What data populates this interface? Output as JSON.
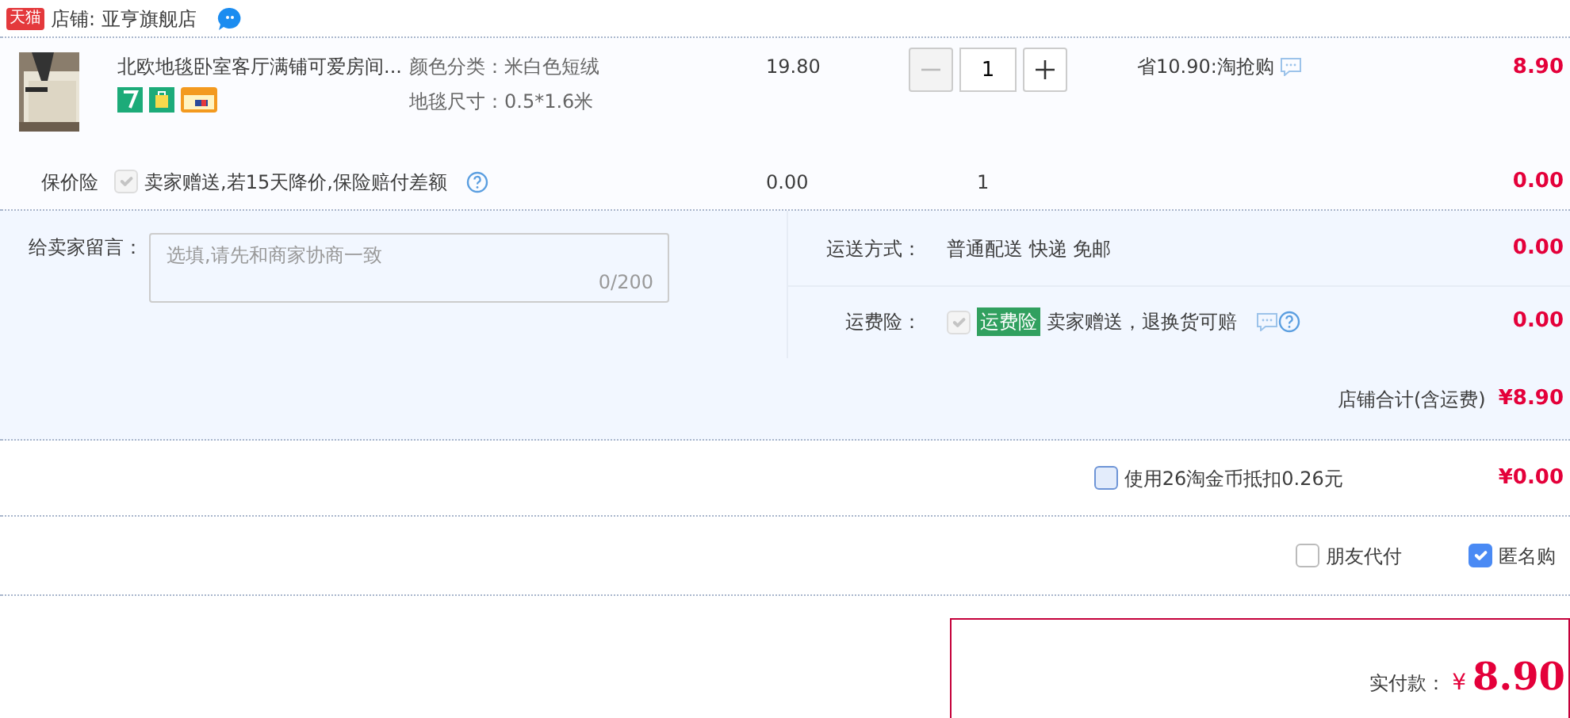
{
  "shop": {
    "badge": "天猫",
    "label": "店铺: 亚亨旗舰店"
  },
  "item": {
    "title": "北欧地毯卧室客厅满铺可爱房间...",
    "sku": [
      "颜色分类：米白色短绒",
      "地毯尺寸：0.5*1.6米"
    ],
    "price": "19.80",
    "quantity": "1",
    "promo": "省10.90:淘抢购",
    "subtotal": "8.90"
  },
  "price_protection": {
    "label": "保价险",
    "checked": true,
    "disabled": true,
    "text": "卖家赠送,若15天降价,保险赔付差额",
    "price": "0.00",
    "quantity": "1",
    "subtotal": "0.00"
  },
  "message": {
    "label": "给卖家留言：",
    "placeholder": "选填,请先和商家协商一致",
    "counter": "0/200"
  },
  "shipping": {
    "label": "运送方式：",
    "value": "普通配送 快递 免邮",
    "fee": "0.00"
  },
  "freight_insurance": {
    "label": "运费险：",
    "checked": true,
    "disabled": true,
    "tag": "运费险",
    "text": "卖家赠送，退换货可赔",
    "fee": "0.00"
  },
  "shop_total": {
    "label": "店铺合计(含运费)",
    "value": "¥8.90"
  },
  "coins": {
    "checked": false,
    "label": "使用26淘金币抵扣0.26元",
    "value": "¥0.00"
  },
  "options": [
    {
      "label": "朋友代付",
      "checked": false
    },
    {
      "label": "匿名购",
      "checked": true
    }
  ],
  "payment": {
    "label": "实付款：",
    "currency": "¥",
    "amount": "8.90"
  }
}
